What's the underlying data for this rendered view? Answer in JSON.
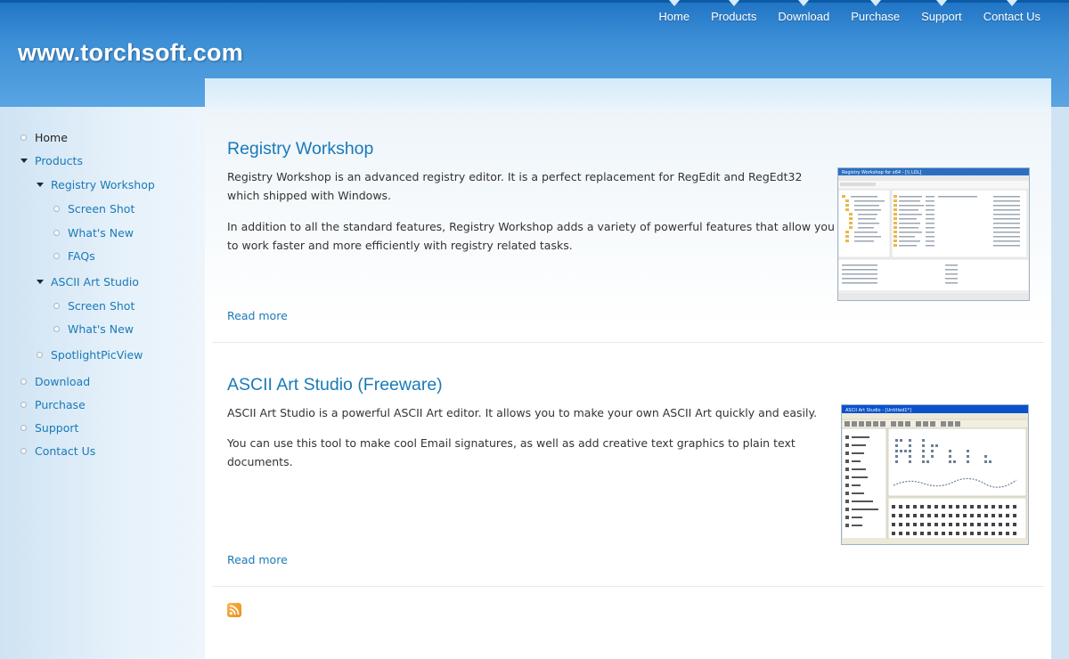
{
  "site": {
    "title": "www.torchsoft.com"
  },
  "topnav": [
    "Home",
    "Products",
    "Download",
    "Purchase",
    "Support",
    "Contact Us"
  ],
  "sidebar": {
    "home": "Home",
    "products": "Products",
    "registry_workshop": "Registry Workshop",
    "rw_screenshot": "Screen Shot",
    "rw_whatsnew": "What's New",
    "rw_faqs": "FAQs",
    "ascii_art_studio": "ASCII Art Studio",
    "aas_screenshot": "Screen Shot",
    "aas_whatsnew": "What's New",
    "spotlight": "SpotlightPicView",
    "download": "Download",
    "purchase": "Purchase",
    "support": "Support",
    "contact": "Contact Us"
  },
  "articles": [
    {
      "title": "Registry Workshop",
      "para1": "Registry Workshop is an advanced registry editor. It is a perfect replacement for RegEdit and RegEdt32 which shipped with Windows.",
      "para2": "In addition to all the standard features, Registry Workshop adds a variety of powerful features that allow you to work faster and more efficiently with registry related tasks.",
      "read_more": "Read more",
      "thumb_window_title": "Registry Workshop for x64 - [\\\\ LOL]"
    },
    {
      "title": "ASCII Art Studio (Freeware)",
      "para1": "ASCII Art Studio is a powerful ASCII Art editor. It allows you to make your own ASCII Art quickly and easily.",
      "para2": "You can use this tool to make cool Email signatures, as well as add creative text graphics to plain text documents.",
      "read_more": "Read more",
      "thumb_window_title": "ASCII Art Studio - [Untitled1*]"
    }
  ],
  "colors": {
    "header": "#3d8fd6",
    "link": "#1a7ab8",
    "rss": "#ee8a14"
  },
  "icons": [
    "rss-icon"
  ]
}
